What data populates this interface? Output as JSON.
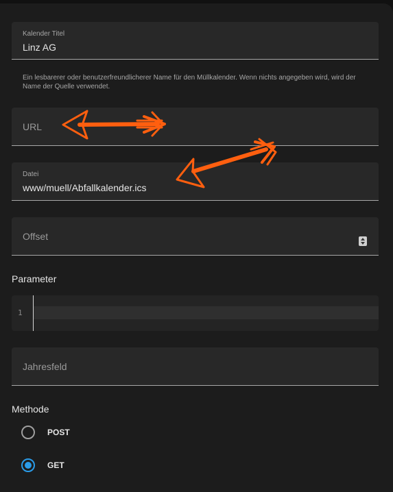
{
  "title_field": {
    "label": "Kalender Titel",
    "value": "Linz AG",
    "helper": "Ein lesbarerer oder benutzerfreundlicherer Name für den Müllkalender. Wenn nichts angegeben wird, wird der Name der Quelle verwendet."
  },
  "url_field": {
    "placeholder": "URL"
  },
  "file_field": {
    "label": "Datei",
    "value": "www/muell/Abfallkalender.ics"
  },
  "offset_field": {
    "placeholder": "Offset"
  },
  "parameter": {
    "title": "Parameter",
    "line_number": "1"
  },
  "year_field": {
    "placeholder": "Jahresfeld"
  },
  "method": {
    "title": "Methode",
    "options": [
      {
        "label": "POST",
        "checked": false
      },
      {
        "label": "GET",
        "checked": true
      }
    ]
  },
  "colors": {
    "background": "#1c1c1c",
    "field": "#282828",
    "accent": "#2a9be8",
    "annotation_arrow": "#ff5f0f"
  }
}
